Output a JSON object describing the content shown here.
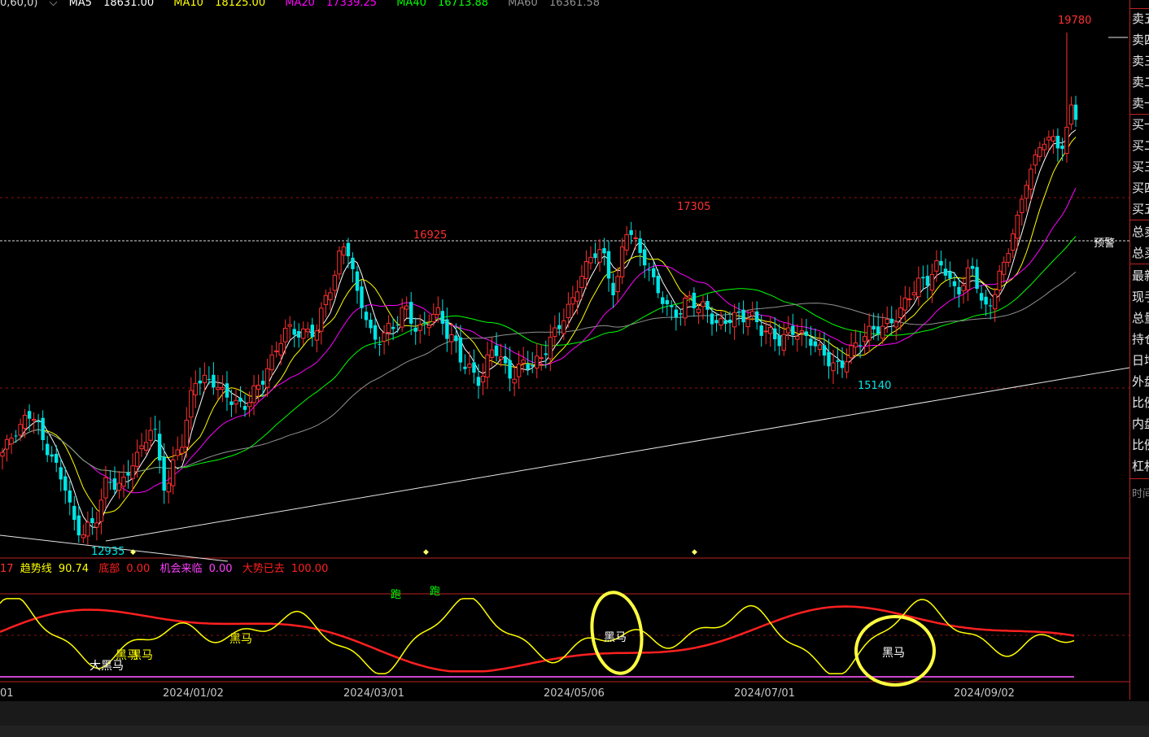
{
  "header": {
    "prefix": "0,60,0)",
    "ma": [
      {
        "label": "MA5",
        "value": "18631.00",
        "color": "#ffffff"
      },
      {
        "label": "MA10",
        "value": "18125.00",
        "color": "#ffff00"
      },
      {
        "label": "MA20",
        "value": "17339.25",
        "color": "#ff00ff"
      },
      {
        "label": "MA40",
        "value": "16713.88",
        "color": "#00ff00"
      },
      {
        "label": "MA60",
        "value": "16361.58",
        "color": "#909090"
      }
    ]
  },
  "indicator_legend": {
    "prefix": "17",
    "items": [
      {
        "label": "趋势线",
        "value": "90.74",
        "color": "#ffff00"
      },
      {
        "label": "底部",
        "value": "0.00",
        "color": "#ff2020"
      },
      {
        "label": "机会来临",
        "value": "0.00",
        "color": "#ff40ff"
      },
      {
        "label": "大势已去",
        "value": "100.00",
        "color": "#ff2020"
      }
    ]
  },
  "sidebar": {
    "items": [
      "卖五",
      "卖四",
      "卖三",
      "卖二",
      "卖一",
      "买一",
      "买二",
      "买三",
      "买四",
      "买五",
      "总卖",
      "总买",
      "最新",
      "现手",
      "总量",
      "持仓",
      "日增",
      "外盘",
      "比例",
      "内盘",
      "比例",
      "杠杆",
      "时间"
    ]
  },
  "annotations": {
    "warning_label": "预警",
    "price_labels": [
      {
        "text": "19780",
        "color": "#ff3030"
      },
      {
        "text": "17305",
        "color": "#ff3030"
      },
      {
        "text": "16925",
        "color": "#ff3030"
      },
      {
        "text": "15140",
        "color": "#00e5e5"
      },
      {
        "text": "12935",
        "color": "#00e5e5"
      }
    ],
    "signal_labels": [
      {
        "text": "大黑马",
        "color": "#ffffff"
      },
      {
        "text": "黑马",
        "color": "#ffff00"
      },
      {
        "text": "黑马",
        "color": "#ffff00"
      },
      {
        "text": "黑马",
        "color": "#ffff00"
      },
      {
        "text": "黑马",
        "color": "#ffffff"
      },
      {
        "text": "黑马",
        "color": "#ffffff"
      },
      {
        "text": "跑",
        "color": "#00ff00"
      },
      {
        "text": "跑",
        "color": "#00ff00"
      }
    ]
  },
  "chart_data": {
    "type": "candlestick",
    "up_color": "#ff3030",
    "down_color": "#00e5e5",
    "x_tick_labels": [
      "01",
      "2024/01/02",
      "2024/03/01",
      "2024/05/06",
      "2024/07/01",
      "2024/09/02"
    ],
    "y_marked_values": [
      19780,
      17305,
      16925,
      15140,
      12935
    ],
    "close_path": [
      14100,
      14350,
      14650,
      14200,
      13700,
      13000,
      13150,
      13700,
      13600,
      14050,
      14500,
      13600,
      14200,
      15150,
      15100,
      14800,
      14700,
      15000,
      15300,
      15700,
      15750,
      15800,
      16300,
      16900,
      16200,
      15600,
      15700,
      16050,
      15800,
      15950,
      15650,
      15350,
      15100,
      15450,
      15150,
      15350,
      15300,
      15650,
      16100,
      16600,
      16800,
      16300,
      17200,
      16700,
      16200,
      16000,
      16200,
      16000,
      15800,
      16000,
      15950,
      15700,
      15650,
      15800,
      15600,
      15400,
      15300,
      15500,
      15650,
      15800,
      16000,
      16250,
      16400,
      16700,
      16300,
      16500,
      16000,
      16600,
      17200,
      17900,
      18400,
      18300,
      18700
    ]
  },
  "ma_series": [
    {
      "name": "MA5",
      "color": "#ffffff"
    },
    {
      "name": "MA10",
      "color": "#ffff00"
    },
    {
      "name": "MA20",
      "color": "#ff00ff"
    },
    {
      "name": "MA40",
      "color": "#00ff00"
    },
    {
      "name": "MA60",
      "color": "#909090"
    }
  ],
  "indicator": {
    "trend_line_color": "#ffff00",
    "base_line_color": "#ff2020",
    "bottom_line_color": "#cc44cc"
  }
}
